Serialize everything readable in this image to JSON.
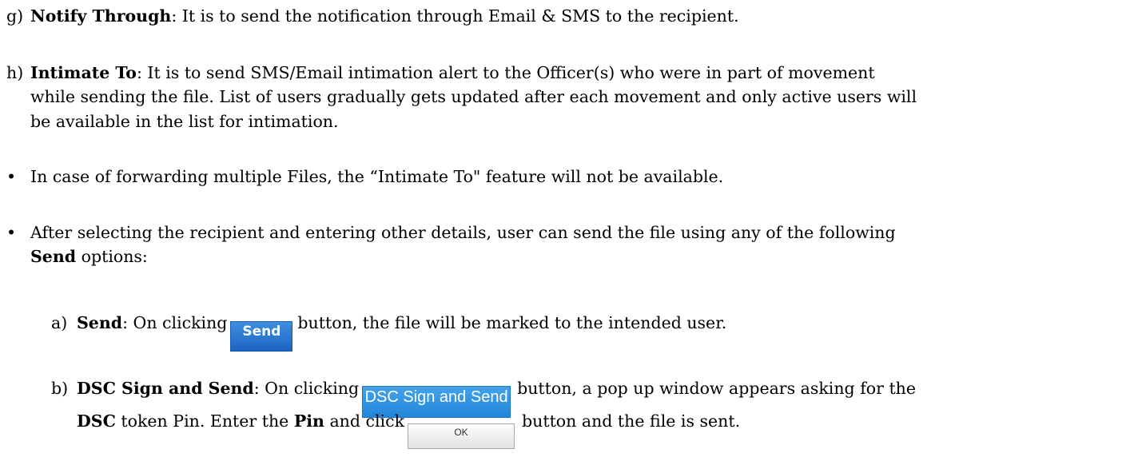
{
  "items": {
    "g": {
      "marker": "g)",
      "term": "Notify Through",
      "text": ": It is to send the notification through Email & SMS to the recipient."
    },
    "h": {
      "marker": "h)",
      "term": "Intimate To",
      "line1_rest": ":  It is to send SMS/Email intimation alert to the Officer(s) who were in part of movement",
      "line2": "while sending the file. List of users gradually gets updated after each movement and only active users will",
      "line3": "be available in the list for intimation."
    }
  },
  "bullets": [
    {
      "symbol": "•",
      "text": "In case of forwarding multiple Files, the “Intimate To\" feature will not be available."
    },
    {
      "symbol": "•",
      "line1": "After selecting the recipient and entering other details, user can send the file using any of the following",
      "line2_term": "Send",
      "line2_rest": " options:"
    }
  ],
  "send_options": {
    "a": {
      "marker": "a)",
      "term": "Send",
      "pre": ": On clicking",
      "button_label": "Send",
      "post": "button, the file will be marked to the intended user."
    },
    "b": {
      "marker": "b)",
      "term": "DSC Sign and Send",
      "pre": ": On clicking",
      "button_label": "DSC Sign and Send",
      "post": "button, a pop up window appears asking for the",
      "line2_term1": "DSC",
      "line2_mid": " token Pin. Enter the ",
      "line2_term2": "Pin",
      "line2_pre_btn": " and click",
      "ok_label": "OK",
      "line2_post": "button and the file is sent."
    }
  },
  "colors": {
    "send_button": "#1c64c2",
    "dsc_button": "#2186d9",
    "ok_button": "#e2e2e2"
  }
}
